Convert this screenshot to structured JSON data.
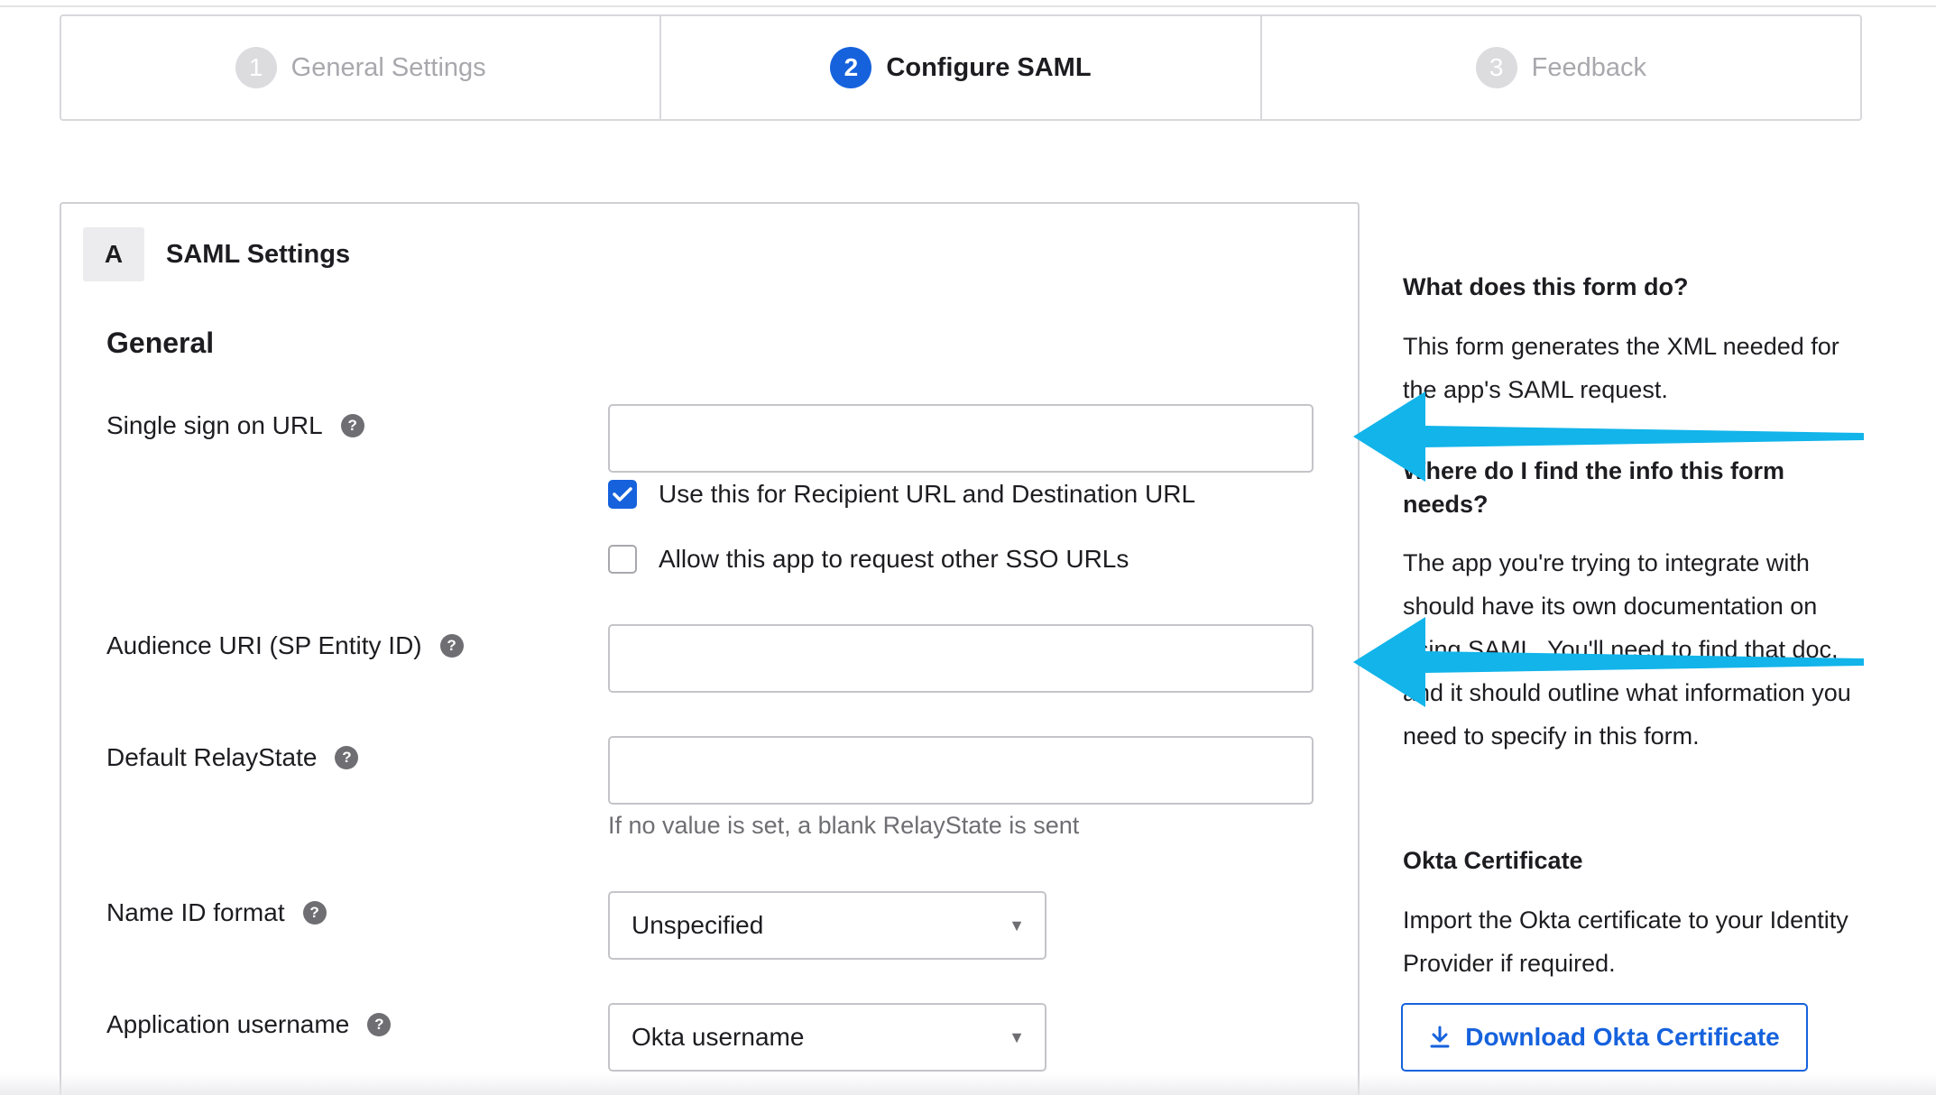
{
  "stepper": {
    "steps": [
      {
        "num": "1",
        "label": "General Settings"
      },
      {
        "num": "2",
        "label": "Configure SAML"
      },
      {
        "num": "3",
        "label": "Feedback"
      }
    ],
    "active_step": "2"
  },
  "panel": {
    "badge": "A",
    "title": "SAML Settings",
    "section": "General",
    "fields": {
      "sso_url": {
        "label": "Single sign on URL",
        "value": ""
      },
      "audience_uri": {
        "label": "Audience URI (SP Entity ID)",
        "value": ""
      },
      "relay_state": {
        "label": "Default RelayState",
        "value": "",
        "hint": "If no value is set, a blank RelayState is sent"
      },
      "name_id_format": {
        "label": "Name ID format",
        "selected": "Unspecified"
      },
      "app_username": {
        "label": "Application username",
        "selected": "Okta username"
      }
    },
    "checkboxes": {
      "recipient": {
        "label": "Use this for Recipient URL and Destination URL",
        "checked": true
      },
      "other_sso": {
        "label": "Allow this app to request other SSO URLs",
        "checked": false
      }
    },
    "help_glyph": "?"
  },
  "sidebar": {
    "q1": "What does this form do?",
    "a1": "This form generates the XML needed for the app's SAML request.",
    "q2": "Where do I find the info this form needs?",
    "a2": "The app you're trying to integrate with should have its own documentation on using SAML. You'll need to find that doc, and it should outline what information you need to specify in this form.",
    "cert_title": "Okta Certificate",
    "cert_text": "Import the Okta certificate to your Identity Provider if required.",
    "download_label": "Download Okta Certificate"
  },
  "colors": {
    "primary": "#1662dd",
    "arrow": "#12b4ea"
  }
}
